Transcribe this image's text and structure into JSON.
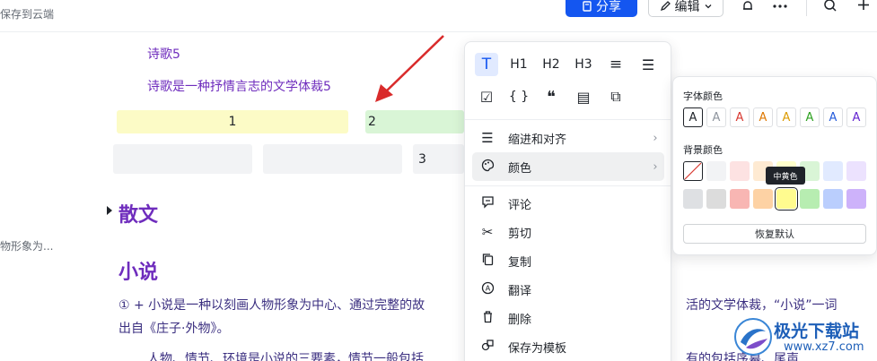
{
  "topbar": {
    "save_status": "保存到云端",
    "share_label": "分享",
    "edit_label": "编辑"
  },
  "icons": {
    "share": "doc-icon",
    "edit": "pen-icon",
    "bell": "bell-icon",
    "more": "more-icon",
    "search": "search-icon",
    "add": "plus-icon"
  },
  "document": {
    "line1": "诗歌5",
    "line2": "诗歌是一种抒情言志的文学体裁5",
    "table": {
      "row1": [
        "1",
        "2"
      ],
      "row2": [
        "",
        "",
        "3"
      ]
    },
    "heading_prose": "散文",
    "heading_novel": "小说",
    "novel_para_1a": "① + 小说是一种以刻画人物形象为中心、通过完整的故",
    "novel_para_1b": "活的文学体裁，“小说”一词",
    "novel_para_2": "出自《庄子·外物》。",
    "novel_para_3a": "人物、情节、环境是小说的三要素，情节一般包括",
    "novel_para_3b": "有的包括序幕、尾声",
    "side_fragment": "物形象为..."
  },
  "menu": {
    "format_buttons": [
      {
        "name": "text",
        "label": "T"
      },
      {
        "name": "h1",
        "label": "H1"
      },
      {
        "name": "h2",
        "label": "H2"
      },
      {
        "name": "h3",
        "label": "H3"
      },
      {
        "name": "ordered-list",
        "label": "≡"
      },
      {
        "name": "bullet-list",
        "label": "☰"
      },
      {
        "name": "todo",
        "label": "☑"
      },
      {
        "name": "code",
        "label": "{ }"
      },
      {
        "name": "quote",
        "label": "❝"
      },
      {
        "name": "callout",
        "label": "▤"
      },
      {
        "name": "sync-block",
        "label": "⧉"
      }
    ],
    "items": {
      "indent_align": "缩进和对齐",
      "color": "颜色",
      "comment": "评论",
      "cut": "剪切",
      "copy": "复制",
      "translate": "翻译",
      "delete": "删除",
      "save_template": "保存为模板"
    }
  },
  "color_panel": {
    "font_color_title": "字体颜色",
    "background_color_title": "背景颜色",
    "font_colors": [
      "#1f2329",
      "#8f959e",
      "#d83931",
      "#de7802",
      "#dc9b04",
      "#2ea121",
      "#245bdb",
      "#6425d0"
    ],
    "bg_colors_row1": [
      "none",
      "#f2f3f5",
      "#fde2e2",
      "#feead2",
      "#ffffcc",
      "#d9f5d6",
      "#e1eaff",
      "#ece2fe"
    ],
    "bg_colors_row2": [
      "#dee0e3",
      "#dcdcdc",
      "#f8b6b3",
      "#fdd2a4",
      "#fffb8f",
      "#b7edb1",
      "#bacefd",
      "#cdb2fa"
    ],
    "glyph": "A",
    "tooltip": "中黄色",
    "reset_label": "恢复默认"
  },
  "watermark": {
    "line1": "极光下载站",
    "line2": "www.xz7.com"
  },
  "colors": {
    "accent": "#1456f0",
    "doc_text": "#6f2dbd",
    "arrow": "#d92b2b",
    "cell_yellow": "#fcfbc6",
    "cell_green": "#d9f5d6",
    "cell_gray": "#f2f3f5"
  }
}
